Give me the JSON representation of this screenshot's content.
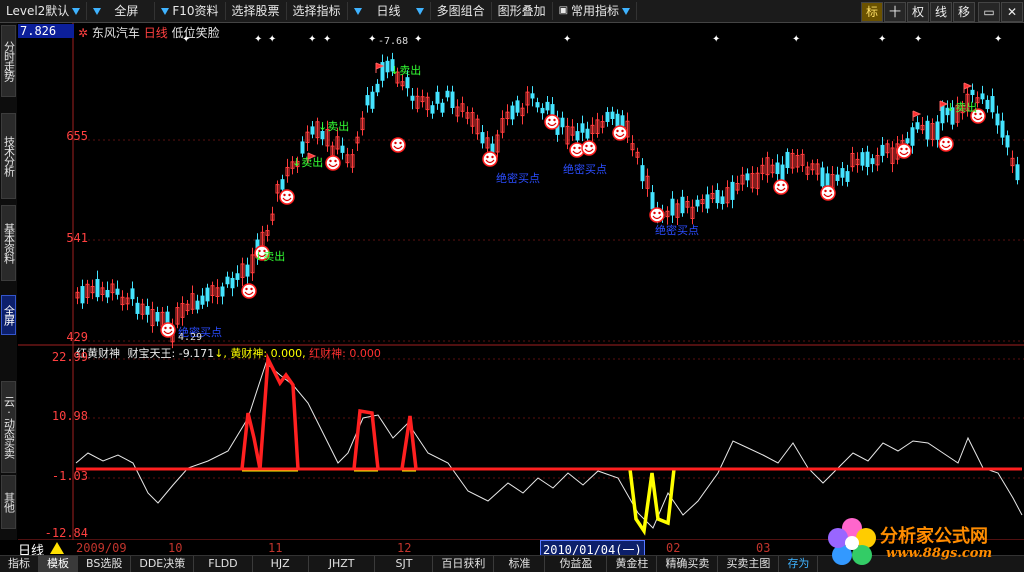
{
  "toolbar": {
    "items": [
      "Level2默认",
      "全屏",
      "F10资料",
      "选择股票",
      "选择指标",
      "日线",
      "多图组合",
      "图形叠加",
      "常用指标"
    ],
    "right_buttons": [
      "标",
      "十",
      "权",
      "线",
      "移"
    ]
  },
  "left_tabs": [
    "分时走势",
    "技术分析",
    "基本资料",
    "全屏",
    "云·动态买卖",
    "其他"
  ],
  "price_chart": {
    "top_label": "7.826",
    "stock_name": "东风汽车",
    "period": "日线",
    "indicator_name": "低位笑脸",
    "y_ticks": [
      "655",
      "541",
      "429"
    ],
    "high_label": "7.68",
    "low_label": "4.29",
    "sell_label": "卖出",
    "buy_label": "绝密买点"
  },
  "indicator": {
    "name": "红黄财神",
    "wealth_label": "财宝天王:",
    "wealth_value": "-9.171",
    "yellow_label": "黄财神:",
    "yellow_value": "0.000,",
    "red_label": "红财神:",
    "red_value": "0.000",
    "y_ticks": [
      "22.99",
      "10.98",
      "-1.03",
      "-12.84"
    ]
  },
  "date_axis": {
    "period_label": "日线",
    "labels": [
      "2009/09",
      "10",
      "11",
      "12",
      "2010/01/04(一)",
      "02",
      "03"
    ]
  },
  "bottom_tabs": [
    "指标",
    "模板",
    "BS选股",
    "DDE决策",
    "FLDD",
    "HJZ",
    "JHZT",
    "SJT",
    "百日获利",
    "标准",
    "伪益盈",
    "黄金柱",
    "精确买卖",
    "买卖主图",
    "存为"
  ],
  "watermark": {
    "text": "分析家公式网",
    "url": "www.88gs.com"
  },
  "colors": {
    "up": "#ff3c3c",
    "down": "#45e4ff",
    "red_line": "#ff2020",
    "yellow": "#ffff00",
    "axis_red": "#c0342c"
  }
}
